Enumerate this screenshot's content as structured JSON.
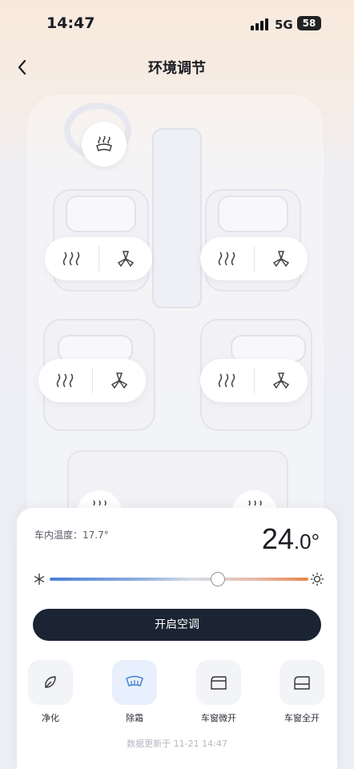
{
  "status_bar": {
    "time": "14:47",
    "network": "5G",
    "battery": "58"
  },
  "header": {
    "title": "环境调节"
  },
  "climate": {
    "indoor_temp": "车内温度：17.7°",
    "set_temp_int": "24",
    "set_temp_dec": ".0°",
    "slider_level": 0.65,
    "ac_button": "开启空调"
  },
  "functions": [
    {
      "label": "净化",
      "icon": "leaf-icon"
    },
    {
      "label": "除霜",
      "icon": "defrost-icon",
      "active": true
    },
    {
      "label": "车窗微开",
      "icon": "window-vent-icon"
    },
    {
      "label": "车窗全开",
      "icon": "window-open-icon"
    }
  ],
  "footer": {
    "updated": "数据更新于 11-21 14:47"
  },
  "colors": {
    "accent": "#1b2433",
    "active_bg": "#e7f0fc",
    "active_icon": "#4a7fd4"
  }
}
